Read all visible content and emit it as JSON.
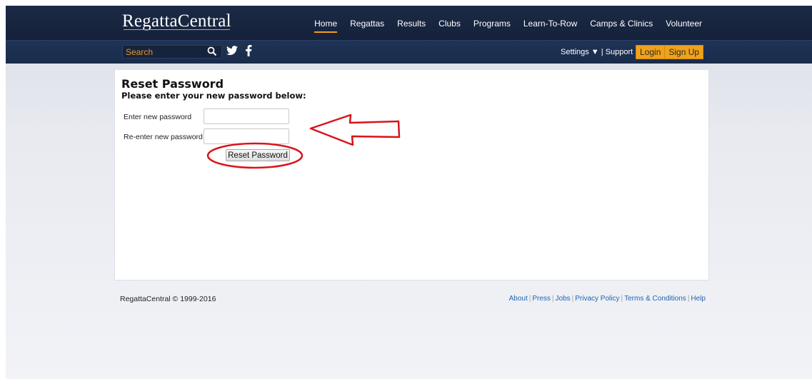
{
  "header": {
    "logo_text": "RegattaCentral",
    "nav": [
      "Home",
      "Regattas",
      "Results",
      "Clubs",
      "Programs",
      "Learn-To-Row",
      "Camps & Clinics",
      "Volunteer"
    ],
    "active_nav": "Home"
  },
  "subbar": {
    "search_placeholder": "Search",
    "settings_label": "Settings ▼",
    "divider": "|",
    "support_label": "Support",
    "login_label": "Login",
    "signup_label": "Sign Up"
  },
  "form": {
    "title": "Reset Password",
    "subtitle": "Please enter your new password below:",
    "new_password_label": "Enter new password",
    "new_password_value": "",
    "confirm_password_label": "Re-enter new password",
    "confirm_password_value": "",
    "submit_label": "Reset Password"
  },
  "annotations": {
    "color": "#d9141b",
    "items": [
      "arrow pointing at password fields",
      "ellipse circling Reset Password button"
    ]
  },
  "footer": {
    "copyright": "RegattaCentral © 1999-2016",
    "links": [
      "About",
      "Press",
      "Jobs",
      "Privacy Policy",
      "Terms & Conditions",
      "Help"
    ]
  },
  "colors": {
    "nav_bg": "#1b2a45",
    "accent_orange": "#f0a21b",
    "link_blue": "#1e63b5"
  }
}
